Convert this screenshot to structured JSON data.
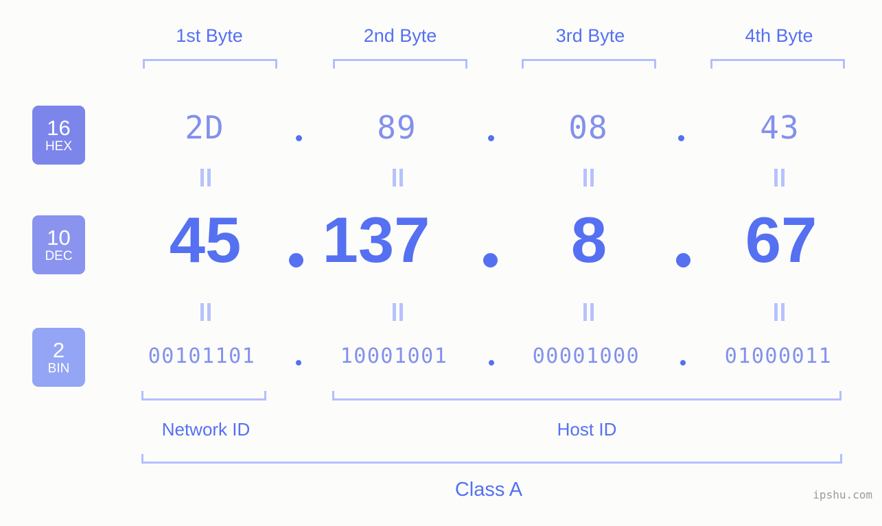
{
  "background_color": "#fcfdfb",
  "accent_color": "#5570f1",
  "muted_accent_color": "#8390ed",
  "bracket_color": "#b3beff",
  "byte_headers": [
    {
      "label": "1st Byte"
    },
    {
      "label": "2nd Byte"
    },
    {
      "label": "3rd Byte"
    },
    {
      "label": "4th Byte"
    }
  ],
  "radix_rows": [
    {
      "base": "16",
      "name": "HEX",
      "badge_color": "#7b85ea",
      "values": [
        "2D",
        "89",
        "08",
        "43"
      ],
      "separator": "."
    },
    {
      "base": "10",
      "name": "DEC",
      "badge_color": "#8a94ef",
      "values": [
        "45",
        "137",
        "8",
        "67"
      ],
      "separator": "."
    },
    {
      "base": "2",
      "name": "BIN",
      "badge_color": "#93a5f4",
      "values": [
        "00101101",
        "10001001",
        "00001000",
        "01000011"
      ],
      "separator": "."
    }
  ],
  "equivalence_symbol": "=",
  "sections": [
    {
      "label": "Network ID"
    },
    {
      "label": "Host ID"
    }
  ],
  "class": {
    "label": "Class A"
  },
  "watermark": {
    "text": "ipshu.com"
  }
}
